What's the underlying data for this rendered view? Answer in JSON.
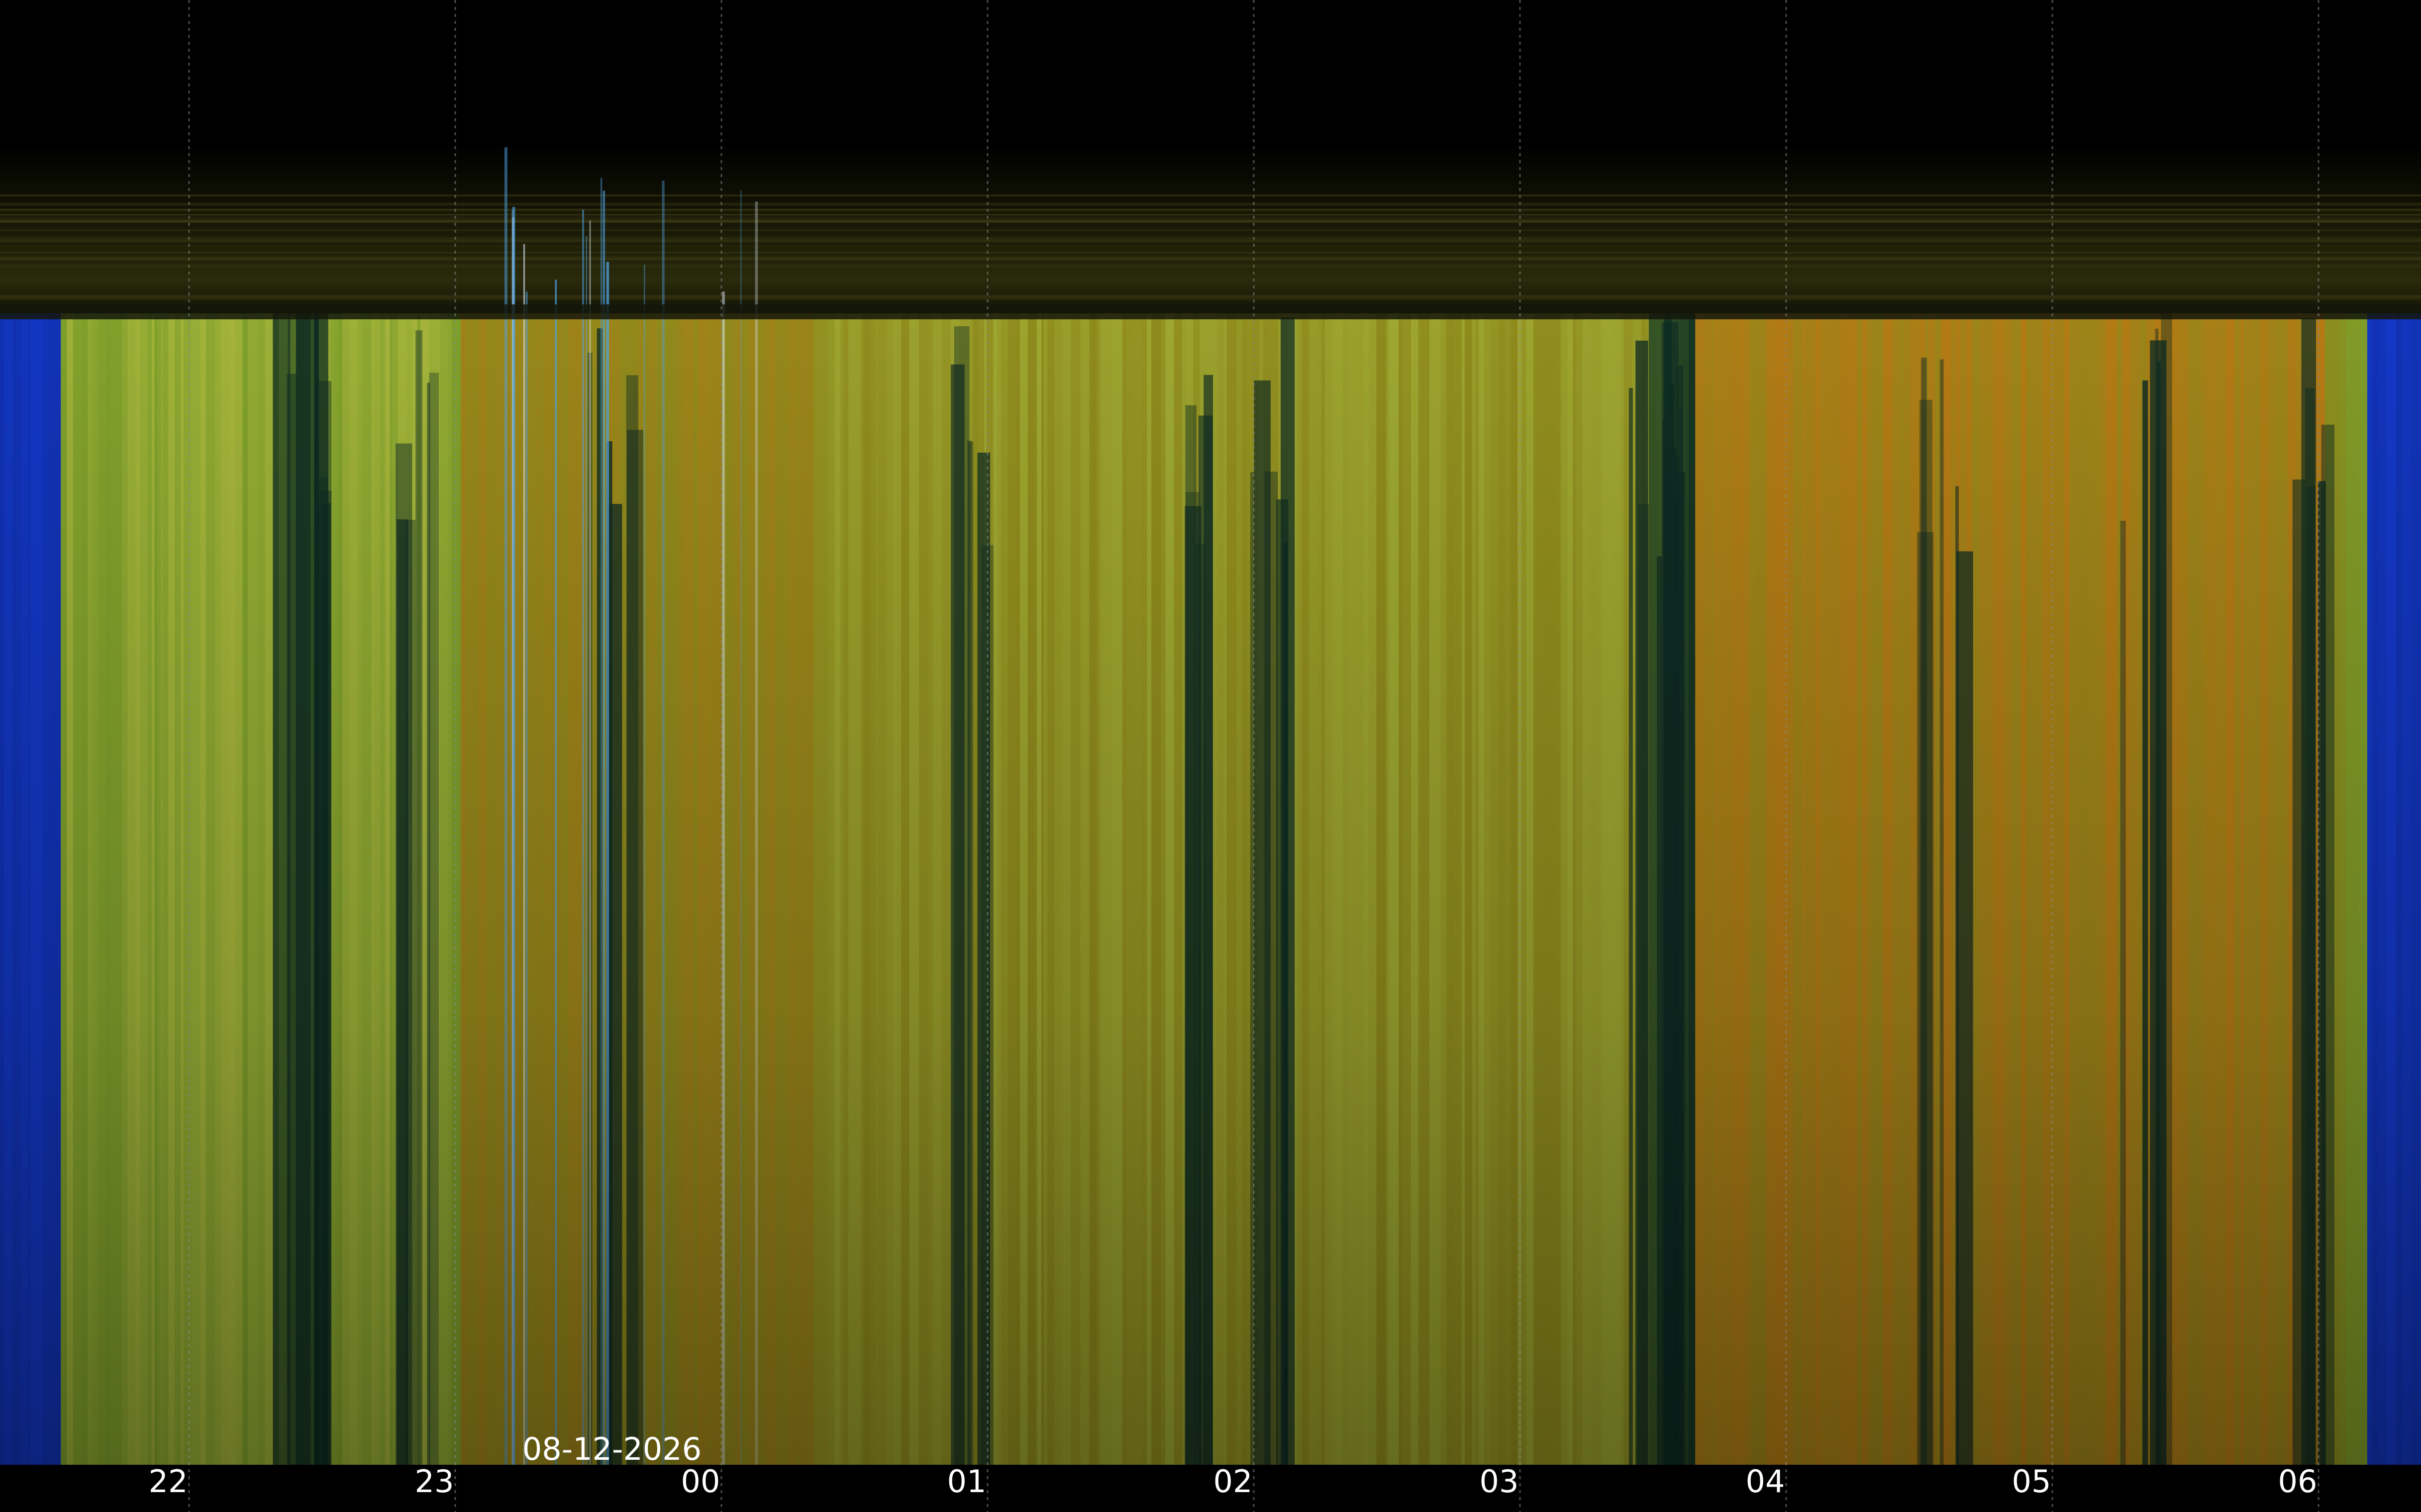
{
  "chart_data": {
    "type": "heatmap",
    "title": "",
    "xlabel": "",
    "ylabel": "",
    "x_axis": {
      "kind": "time",
      "tick_labels": [
        "22",
        "23",
        "00",
        "01",
        "02",
        "03",
        "04",
        "05",
        "06"
      ],
      "date_annotation": {
        "text": "08-12-2026",
        "at_tick": "00"
      },
      "grid": true,
      "grid_style": "dotted",
      "range_hours": [
        21.3,
        6.45
      ]
    },
    "colors": {
      "background": "#000000",
      "low_noise": "#0a0d02",
      "blue_band": "#1438c8",
      "light_blue_band": "#4ea3e6",
      "green": "#7d9e2a",
      "yellow_green": "#a4b43a",
      "olive": "#8f8a1c",
      "orange": "#b47a14",
      "dark_teal": "#0d2a22",
      "tick_text": "#ffffff",
      "grid": "#8a8a8a"
    },
    "legend": "none"
  }
}
